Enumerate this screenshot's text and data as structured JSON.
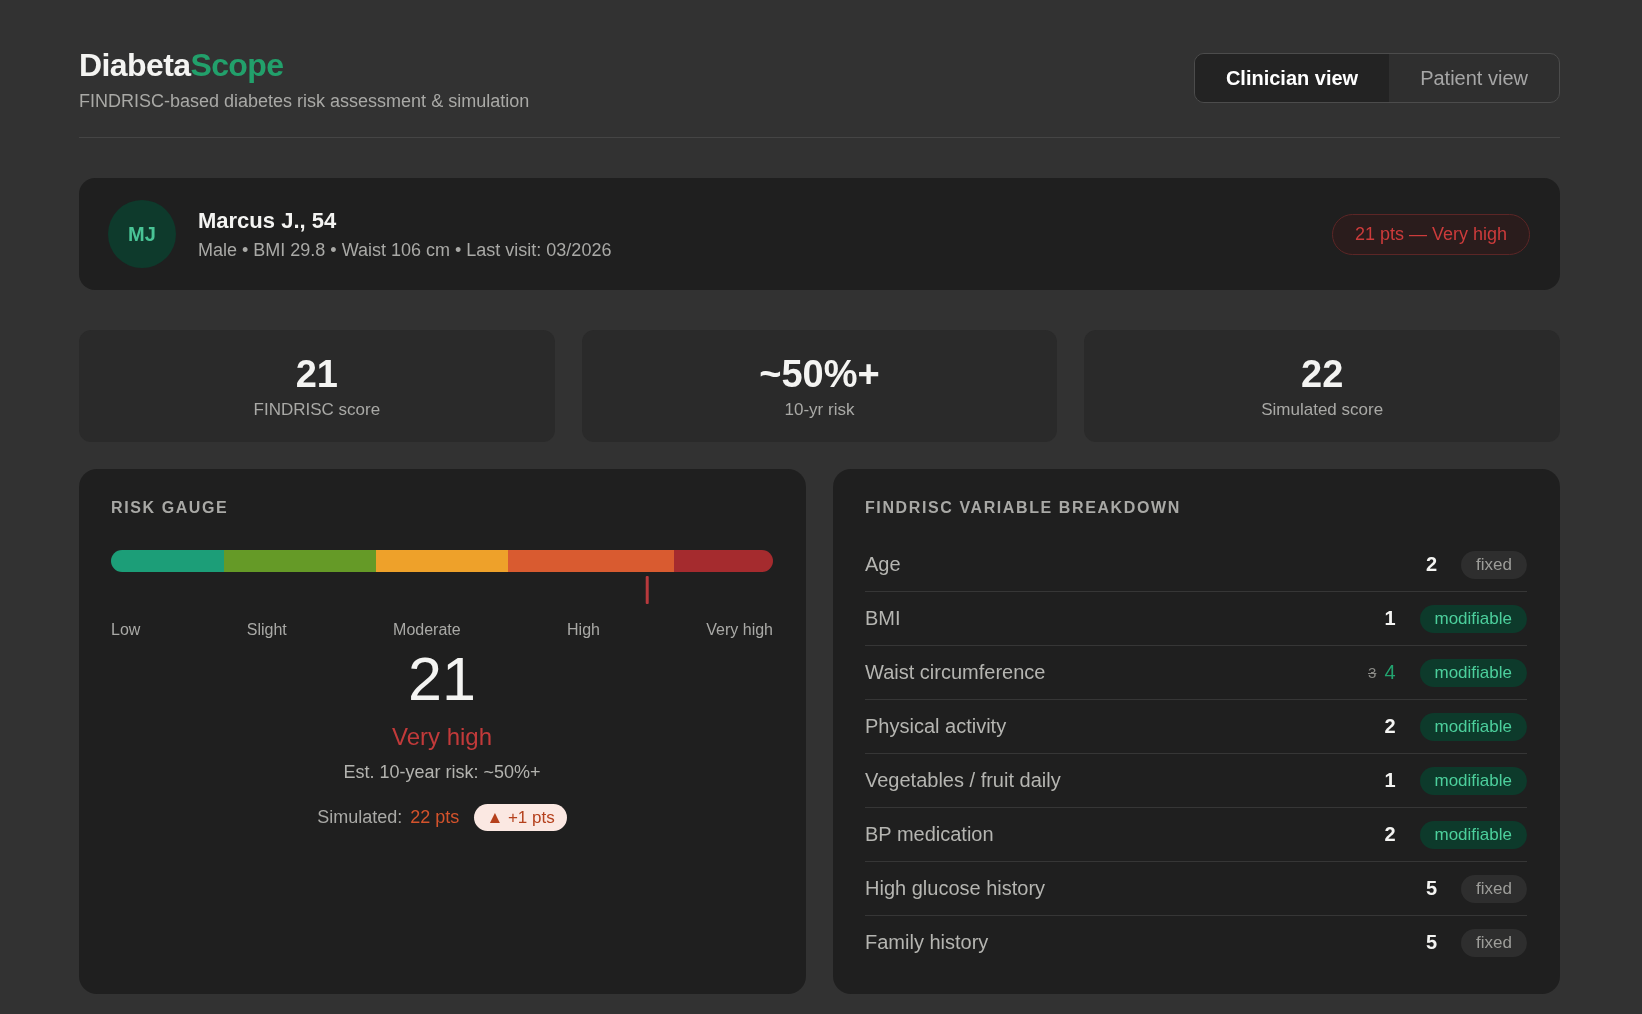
{
  "header": {
    "logo": {
      "primary": "Diabeta",
      "accent": "Scope"
    },
    "subtitle": "FINDRISC-based diabetes risk assessment & simulation",
    "view_tabs": [
      {
        "label": "Clinician view",
        "selected": true
      },
      {
        "label": "Patient view",
        "selected": false
      }
    ]
  },
  "patient": {
    "initials": "MJ",
    "name": "Marcus J., 54",
    "details": "Male • BMI 29.8 • Waist 106 cm • Last visit: 03/2026",
    "risk_badge": "21 pts — Very high"
  },
  "stats": [
    {
      "value": "21",
      "label": "FINDRISC score"
    },
    {
      "value": "~50%+",
      "label": "10-yr risk"
    },
    {
      "value": "22",
      "label": "Simulated score"
    }
  ],
  "risk_gauge": {
    "title": "RISK GAUGE",
    "bands": [
      {
        "label": "Low",
        "color": "#1c9e78"
      },
      {
        "label": "Slight",
        "color": "#659a27"
      },
      {
        "label": "Moderate",
        "color": "#eea12a"
      },
      {
        "label": "High",
        "color": "#d95b30"
      },
      {
        "label": "Very high",
        "color": "#a52b2e"
      }
    ],
    "marker": {
      "level": 0.81
    },
    "score": "21",
    "category": "Very high",
    "estimate": "Est. 10-year risk: ~50%+",
    "simulated_label": "Simulated:",
    "simulated_value": "22 pts",
    "simulated_change": "▲ +1 pts"
  },
  "breakdown": {
    "title": "FINDRISC VARIABLE BREAKDOWN",
    "rows": [
      {
        "label": "Age",
        "points": "2",
        "kind": "fixed",
        "tag": "fixed"
      },
      {
        "label": "BMI",
        "points": "1",
        "kind": "modifiable",
        "tag": "modifiable"
      },
      {
        "label": "Waist circumference",
        "previous_points": "3",
        "points": "4",
        "kind": "modifiable",
        "tag": "modifiable"
      },
      {
        "label": "Physical activity",
        "points": "2",
        "kind": "modifiable",
        "tag": "modifiable"
      },
      {
        "label": "Vegetables / fruit daily",
        "points": "1",
        "kind": "modifiable",
        "tag": "modifiable"
      },
      {
        "label": "BP medication",
        "points": "2",
        "kind": "modifiable",
        "tag": "modifiable"
      },
      {
        "label": "High glucose history",
        "points": "5",
        "kind": "fixed",
        "tag": "fixed"
      },
      {
        "label": "Family history",
        "points": "5",
        "kind": "fixed",
        "tag": "fixed"
      }
    ]
  }
}
